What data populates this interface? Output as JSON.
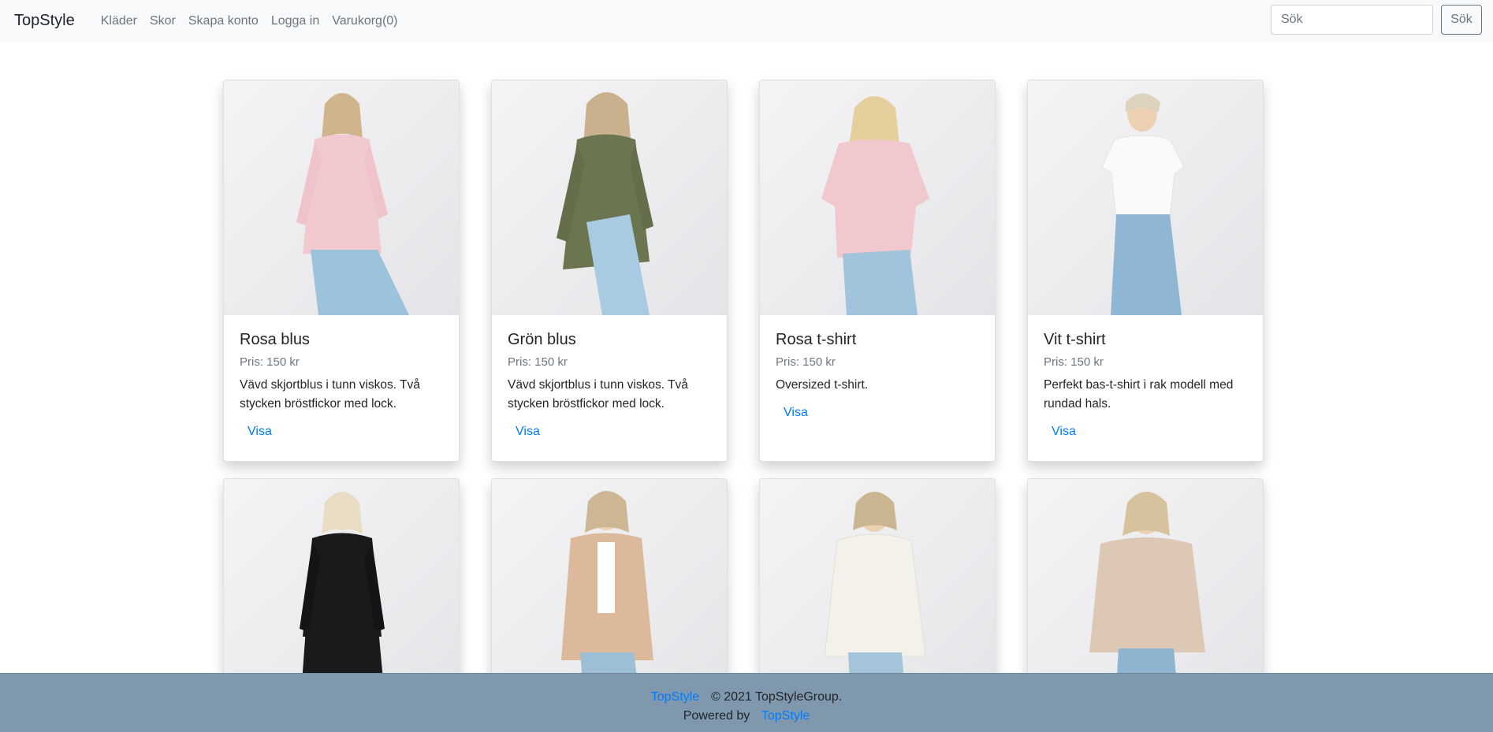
{
  "navbar": {
    "brand": "TopStyle",
    "items": [
      "Kläder",
      "Skor",
      "Skapa konto",
      "Logga in",
      "Varukorg(0)"
    ],
    "search_placeholder": "Sök",
    "search_button": "Sök"
  },
  "products": [
    {
      "title": "Rosa blus",
      "price": "Pris: 150 kr",
      "text": "Vävd skjortblus i tunn viskos. Två stycken bröstfickor med lock.",
      "link": "Visa",
      "color": "#f2c9cf",
      "icon": "pink-blouse"
    },
    {
      "title": "Grön blus",
      "price": "Pris: 150 kr",
      "text": "Vävd skjortblus i tunn viskos. Två stycken bröstfickor med lock.",
      "link": "Visa",
      "color": "#6b7550",
      "icon": "green-blouse"
    },
    {
      "title": "Rosa t-shirt",
      "price": "Pris: 150 kr",
      "text": "Oversized t-shirt.",
      "link": "Visa",
      "color": "#f1c8cd",
      "icon": "pink-tshirt"
    },
    {
      "title": "Vit t-shirt",
      "price": "Pris: 150 kr",
      "text": "Perfekt bas-t-shirt i rak modell med rundad hals.",
      "link": "Visa",
      "color": "#fafafa",
      "icon": "white-tshirt"
    },
    {
      "title": "",
      "price": "",
      "text": "",
      "link": "",
      "color": "#1a1a1c",
      "icon": "black-turtleneck"
    },
    {
      "title": "",
      "price": "",
      "text": "",
      "link": "",
      "color": "#dcb99b",
      "icon": "teddy-jacket"
    },
    {
      "title": "",
      "price": "",
      "text": "",
      "link": "",
      "color": "#f3f1ea",
      "icon": "white-fleece"
    },
    {
      "title": "",
      "price": "",
      "text": "",
      "link": "",
      "color": "#dcc8b4",
      "icon": "beige-sweater"
    }
  ],
  "footer": {
    "brand_link": "TopStyle",
    "copyright": "© 2021 TopStyleGroup.",
    "powered_by": "Powered by",
    "powered_link": "TopStyle"
  }
}
